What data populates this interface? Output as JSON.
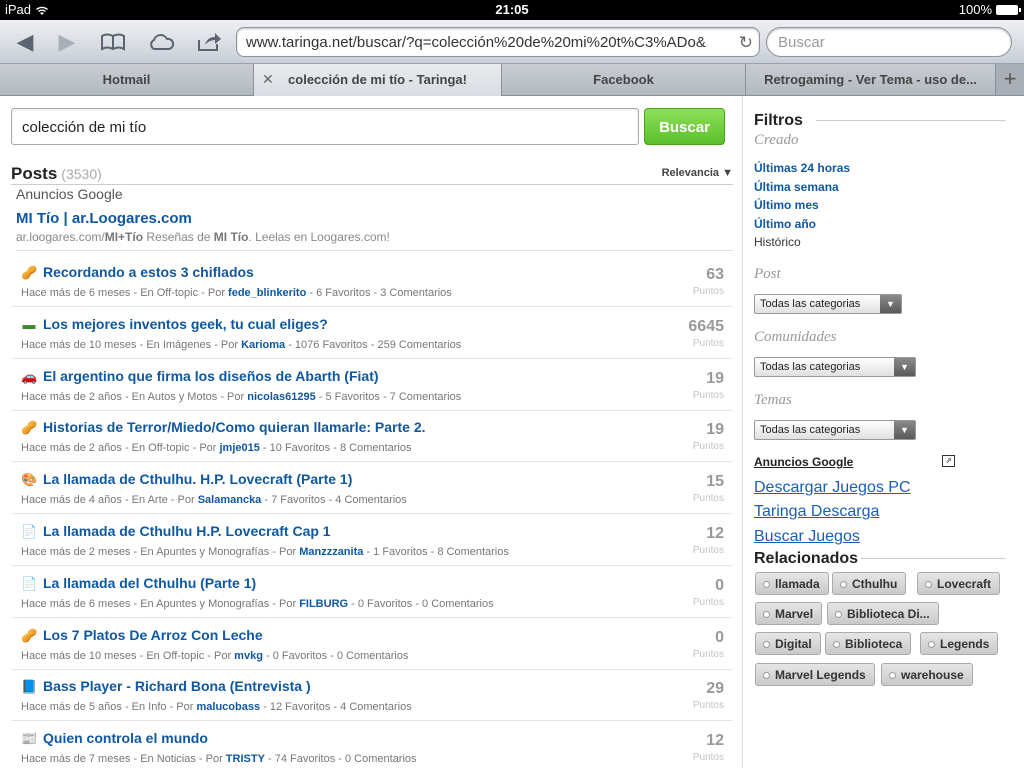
{
  "status": {
    "device": "iPad",
    "time": "21:05",
    "battery": "100%"
  },
  "browser": {
    "url": "www.taringa.net/buscar/?q=colección%20de%20mi%20t%C3%ADo&",
    "search_placeholder": "Buscar",
    "tabs": [
      {
        "label": "Hotmail"
      },
      {
        "label": "colección de mi tío - Taringa!"
      },
      {
        "label": "Facebook"
      },
      {
        "label": "Retrogaming - Ver Tema - uso de..."
      }
    ],
    "new_tab": "+"
  },
  "search": {
    "query": "colección de mi tío",
    "button": "Buscar"
  },
  "posts_header": {
    "title": "Posts",
    "count": "(3530)",
    "sort": "Relevancia"
  },
  "ads": {
    "label": "Anuncios Google",
    "title": "MI Tío | ar.Loogares.com",
    "url_prefix": "ar.loogares.com/",
    "url_bold": "MI+Tío",
    "desc_pre": " Reseñas de ",
    "desc_bold": "MI Tío",
    "desc_post": ". Leelas en Loogares.com!"
  },
  "results": [
    {
      "icon": "offtopic-icon",
      "title": "Recordando a estos 3 chiflados",
      "meta": "Hace más de 6 meses - En Off-topic - Por ",
      "user": "fede_blinkerito",
      "meta2": " - 6 Favoritos - 3 Comentarios",
      "points": "63",
      "points_label": "Puntos"
    },
    {
      "icon": "images-icon",
      "title": "Los mejores inventos geek, tu cual eliges?",
      "meta": "Hace más de 10 meses - En Imágenes - Por ",
      "user": "Karioma",
      "meta2": " - 1076 Favoritos - 259 Comentarios",
      "points": "6645",
      "points_label": "Puntos"
    },
    {
      "icon": "car-icon",
      "title": "El argentino que firma los diseños de Abarth (Fiat)",
      "meta": "Hace más de 2 años - En Autos y Motos - Por ",
      "user": "nicolas61295",
      "meta2": " - 5 Favoritos - 7 Comentarios",
      "points": "19",
      "points_label": "Puntos"
    },
    {
      "icon": "offtopic-icon",
      "title": "Historias de Terror/Miedo/Como quieran llamarle: Parte 2.",
      "meta": "Hace más de 2 años - En Off-topic - Por ",
      "user": "jmje015",
      "meta2": " - 10 Favoritos - 8 Comentarios",
      "points": "19",
      "points_label": "Puntos"
    },
    {
      "icon": "art-icon",
      "title": "La llamada de Cthulhu. H.P. Lovecraft (Parte 1)",
      "meta": "Hace más de 4 años - En Arte - Por ",
      "user": "Salamancka",
      "meta2": " - 7 Favoritos - 4 Comentarios",
      "points": "15",
      "points_label": "Puntos"
    },
    {
      "icon": "notes-icon",
      "title": "La llamada de Cthulhu H.P. Lovecraft Cap 1",
      "meta": "Hace más de 2 meses - En Apuntes y Monografías - Por ",
      "user": "Manzzzanita",
      "meta2": " - 1 Favoritos - 8 Comentarios",
      "points": "12",
      "points_label": "Puntos"
    },
    {
      "icon": "notes-icon",
      "title": "La llamada del Cthulhu (Parte 1)",
      "meta": "Hace más de 6 meses - En Apuntes y Monografías - Por ",
      "user": "FILBURG",
      "meta2": " - 0 Favoritos - 0 Comentarios",
      "points": "0",
      "points_label": "Puntos"
    },
    {
      "icon": "offtopic-icon",
      "title": "Los 7 Platos De Arroz Con Leche",
      "meta": "Hace más de 10 meses - En Off-topic - Por ",
      "user": "mvkg",
      "meta2": " - 0 Favoritos - 0 Comentarios",
      "points": "0",
      "points_label": "Puntos"
    },
    {
      "icon": "book-icon",
      "title": "Bass Player - Richard Bona (Entrevista )",
      "meta": "Hace más de 5 años - En Info - Por ",
      "user": "malucobass",
      "meta2": " - 12 Favoritos - 4 Comentarios",
      "points": "29",
      "points_label": "Puntos"
    },
    {
      "icon": "news-icon",
      "title": "Quien controla el mundo",
      "meta": "Hace más de 7 meses - En Noticias - Por ",
      "user": "TRISTY",
      "meta2": " - 74 Favoritos - 0 Comentarios",
      "points": "12",
      "points_label": "Puntos"
    }
  ],
  "sidebar": {
    "title": "Filtros",
    "created_label": "Creado",
    "created_links": [
      "Últimas 24 horas",
      "Última semana",
      "Último mes",
      "Último año"
    ],
    "created_plain": "Histórico",
    "post_label": "Post",
    "post_select": "Todas las categorias",
    "comunidades_label": "Comunidades",
    "comunidades_select": "Todas las categorias",
    "temas_label": "Temas",
    "temas_select": "Todas las categorias",
    "ads_title": "Anuncios Google",
    "ad_links": [
      "Descargar Juegos PC",
      "Taringa Descarga",
      "Buscar Juegos"
    ],
    "related_title": "Relacionados",
    "tags": [
      "llamada",
      "Cthulhu",
      "Lovecraft",
      "Marvel",
      "Biblioteca Di...",
      "Digital",
      "Biblioteca",
      "Legends",
      "Marvel Legends",
      "warehouse"
    ]
  }
}
